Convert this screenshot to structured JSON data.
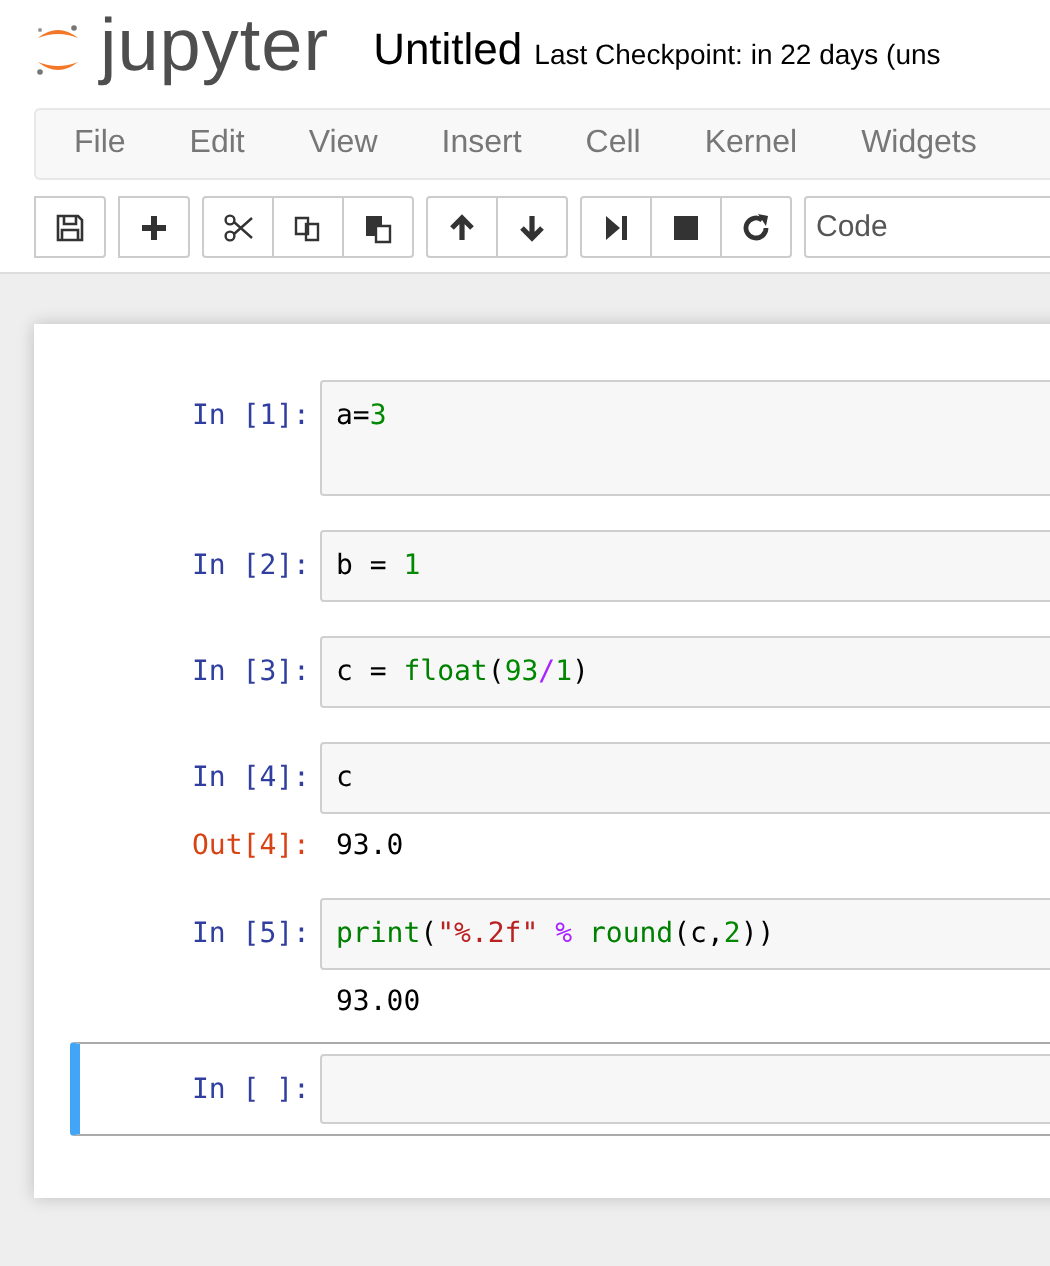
{
  "header": {
    "logo": "jupyter",
    "notebook_name": "Untitled",
    "checkpoint": "Last Checkpoint: in 22 days (uns"
  },
  "menu": [
    "File",
    "Edit",
    "View",
    "Insert",
    "Cell",
    "Kernel",
    "Widgets"
  ],
  "toolbar": {
    "groups": [
      [
        {
          "kind": "save"
        }
      ],
      [
        {
          "kind": "add"
        }
      ],
      [
        {
          "kind": "cut"
        },
        {
          "kind": "copy"
        },
        {
          "kind": "paste"
        }
      ],
      [
        {
          "kind": "up"
        },
        {
          "kind": "down"
        }
      ],
      [
        {
          "kind": "run"
        },
        {
          "kind": "stop"
        },
        {
          "kind": "restart"
        }
      ]
    ],
    "cell_type": "Code"
  },
  "cells": [
    {
      "prompt": "In [1]:",
      "selected": false,
      "code": [
        {
          "kind": "plain",
          "text": "a="
        },
        {
          "kind": "number",
          "text": "3"
        }
      ],
      "tall": true
    },
    {
      "prompt": "In [2]:",
      "selected": false,
      "code": [
        {
          "kind": "plain",
          "text": "b = "
        },
        {
          "kind": "number",
          "text": "1"
        }
      ],
      "tall": false
    },
    {
      "prompt": "In [3]:",
      "selected": false,
      "code": [
        {
          "kind": "plain",
          "text": "c = "
        },
        {
          "kind": "builtin",
          "text": "float"
        },
        {
          "kind": "plain",
          "text": "("
        },
        {
          "kind": "number",
          "text": "93"
        },
        {
          "kind": "operator",
          "text": "/"
        },
        {
          "kind": "number",
          "text": "1"
        },
        {
          "kind": "plain",
          "text": ")"
        }
      ],
      "tall": false
    },
    {
      "prompt": "In [4]:",
      "selected": false,
      "code": [
        {
          "kind": "plain",
          "text": "c"
        }
      ],
      "tall": false,
      "output": {
        "prompt": "Out[4]:",
        "text": "93.0"
      }
    },
    {
      "prompt": "In [5]:",
      "selected": false,
      "code": [
        {
          "kind": "builtin",
          "text": "print"
        },
        {
          "kind": "plain",
          "text": "("
        },
        {
          "kind": "string",
          "text": "\"%.2f\""
        },
        {
          "kind": "operator",
          "text": " % "
        },
        {
          "kind": "builtin",
          "text": "round"
        },
        {
          "kind": "plain",
          "text": "(c,"
        },
        {
          "kind": "number",
          "text": "2"
        },
        {
          "kind": "plain",
          "text": "))"
        }
      ],
      "tall": false,
      "output": {
        "text": "93.00"
      }
    },
    {
      "prompt": "In [ ]:",
      "selected": true,
      "tall": false
    }
  ]
}
